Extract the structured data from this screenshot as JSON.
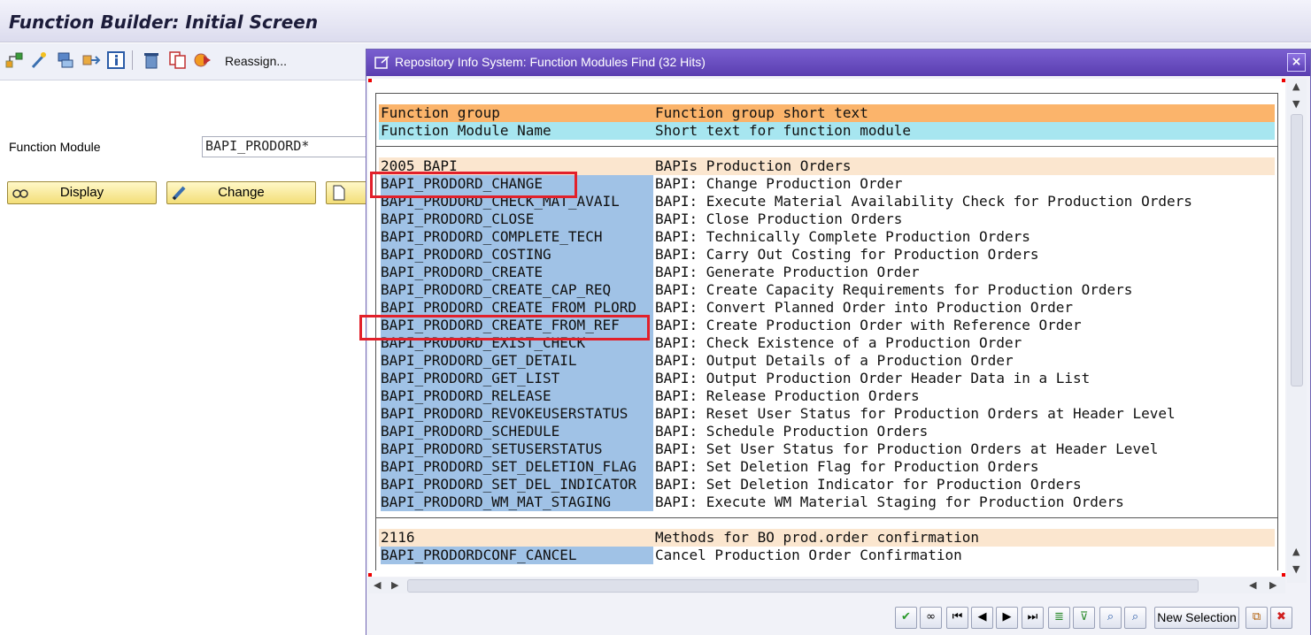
{
  "screen": {
    "title": "Function Builder: Initial Screen",
    "toolbar": {
      "icons": [
        "other-object-icon",
        "magic-wand-icon",
        "where-used-icon",
        "transport-icon",
        "info-icon",
        "delete-icon",
        "copy-icon",
        "rename-icon"
      ],
      "reassign_label": "Reassign..."
    },
    "function_module_label": "Function Module",
    "function_module_value": "BAPI_PRODORD*",
    "display_label": "Display",
    "change_label": "Change"
  },
  "dialog": {
    "title": "Repository Info System: Function Modules Find (32 Hits)",
    "close_glyph": "×",
    "header": [
      {
        "col1": "Function group",
        "col2": "Function group short text"
      },
      {
        "col1": "Function Module Name",
        "col2": "Short text for function module"
      }
    ],
    "groups": [
      {
        "name": "2005 BAPI",
        "text": "BAPIs Production Orders",
        "items": [
          {
            "name": "BAPI_PRODORD_CHANGE",
            "text": "BAPI: Change Production Order"
          },
          {
            "name": "BAPI_PRODORD_CHECK_MAT_AVAIL",
            "text": "BAPI: Execute Material Availability Check for Production Orders"
          },
          {
            "name": "BAPI_PRODORD_CLOSE",
            "text": "BAPI: Close Production Orders"
          },
          {
            "name": "BAPI_PRODORD_COMPLETE_TECH",
            "text": "BAPI: Technically Complete Production Orders"
          },
          {
            "name": "BAPI_PRODORD_COSTING",
            "text": "BAPI: Carry Out Costing for Production Orders"
          },
          {
            "name": "BAPI_PRODORD_CREATE",
            "text": "BAPI: Generate Production Order"
          },
          {
            "name": "BAPI_PRODORD_CREATE_CAP_REQ",
            "text": "BAPI: Create Capacity Requirements for Production Orders"
          },
          {
            "name": "BAPI_PRODORD_CREATE_FROM_PLORD",
            "text": "BAPI: Convert Planned Order into Production Order"
          },
          {
            "name": "BAPI_PRODORD_CREATE_FROM_REF",
            "text": "BAPI: Create Production Order with Reference Order"
          },
          {
            "name": "BAPI_PRODORD_EXIST_CHECK",
            "text": "BAPI: Check Existence of a Production Order"
          },
          {
            "name": "BAPI_PRODORD_GET_DETAIL",
            "text": "BAPI: Output Details of a Production Order"
          },
          {
            "name": "BAPI_PRODORD_GET_LIST",
            "text": "BAPI: Output Production Order Header Data in a List"
          },
          {
            "name": "BAPI_PRODORD_RELEASE",
            "text": "BAPI: Release Production Orders"
          },
          {
            "name": "BAPI_PRODORD_REVOKEUSERSTATUS",
            "text": "BAPI: Reset User Status for Production Orders at Header Level"
          },
          {
            "name": "BAPI_PRODORD_SCHEDULE",
            "text": "BAPI: Schedule Production Orders"
          },
          {
            "name": "BAPI_PRODORD_SETUSERSTATUS",
            "text": "BAPI: Set User Status for Production Orders at Header Level"
          },
          {
            "name": "BAPI_PRODORD_SET_DELETION_FLAG",
            "text": "BAPI: Set Deletion Flag for Production Orders"
          },
          {
            "name": "BAPI_PRODORD_SET_DEL_INDICATOR",
            "text": "BAPI: Set Deletion Indicator for Production Orders"
          },
          {
            "name": "BAPI_PRODORD_WM_MAT_STAGING",
            "text": "BAPI: Execute WM Material Staging for Production Orders"
          }
        ]
      },
      {
        "name": "2116",
        "text": "Methods for BO prod.order confirmation",
        "items": [
          {
            "name": "BAPI_PRODORDCONF_CANCEL",
            "text": "Cancel Production Order Confirmation"
          }
        ]
      }
    ],
    "highlighted_items": [
      "BAPI_PRODORD_CHANGE",
      "BAPI_PRODORD_CREATE_FROM_REF"
    ],
    "buttons": {
      "continue_icon": "checkmark-icon",
      "new_selection_label": "New Selection",
      "cancel_glyph": "✖"
    },
    "colors": {
      "header_row_1": "#fbb46b",
      "header_row_2": "#a7e6f0",
      "group_row": "#fbe6cf",
      "name_cell": "#a0c2e6",
      "highlight_box": "#e2202a",
      "dialog_title": "#6a4ec4"
    }
  }
}
